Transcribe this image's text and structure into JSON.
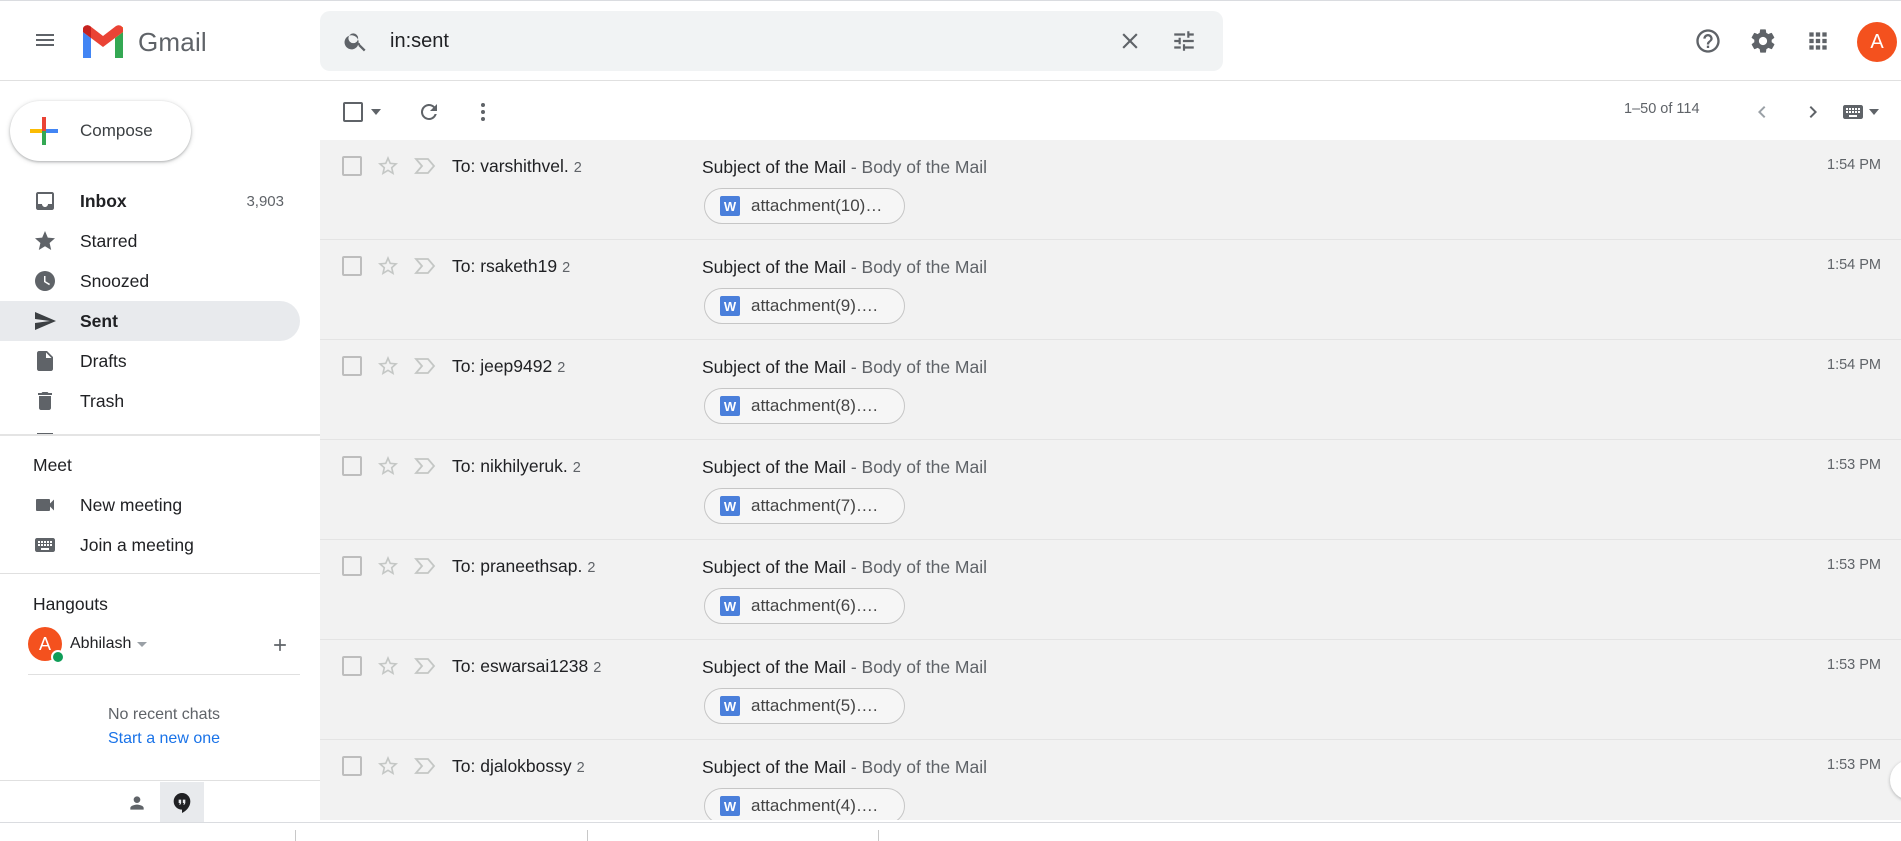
{
  "app": {
    "name": "Gmail",
    "colors": {
      "accent": "#1a73e8",
      "active_nav": "#e8eaed",
      "avatar": "#f4511e",
      "online": "#0f9d58",
      "word_icon": "#4a7fdb"
    }
  },
  "header": {
    "logo_text": "Gmail",
    "search_value": "in:sent",
    "avatar_letter": "A",
    "icons": [
      "menu-icon",
      "search-icon",
      "clear-icon",
      "tune-icon",
      "help-icon",
      "settings-icon",
      "apps-icon"
    ]
  },
  "sidebar": {
    "compose_label": "Compose",
    "items": [
      {
        "label": "Inbox",
        "count": "3,903",
        "icon": "inbox-icon",
        "bold": true,
        "active": false
      },
      {
        "label": "Starred",
        "count": "",
        "icon": "star-icon",
        "bold": false,
        "active": false
      },
      {
        "label": "Snoozed",
        "count": "",
        "icon": "clock-icon",
        "bold": false,
        "active": false
      },
      {
        "label": "Sent",
        "count": "",
        "icon": "send-icon",
        "bold": true,
        "active": true
      },
      {
        "label": "Drafts",
        "count": "",
        "icon": "draft-icon",
        "bold": false,
        "active": false
      },
      {
        "label": "Trash",
        "count": "",
        "icon": "trash-icon",
        "bold": false,
        "active": false
      }
    ],
    "meet": {
      "title": "Meet",
      "new_meeting": "New meeting",
      "join_meeting": "Join a meeting"
    },
    "hangouts": {
      "title": "Hangouts",
      "user_name": "Abhilash",
      "user_initial": "A",
      "no_chats": "No recent chats",
      "start_new": "Start a new one"
    }
  },
  "toolbar": {
    "pager": "1–50 of 114"
  },
  "emails": [
    {
      "to": "To: varshithvel.",
      "count": "2",
      "subject": "Subject of the Mail",
      "snippet": " - Body of the Mail",
      "attachment": "attachment(10)…",
      "time": "1:54 PM"
    },
    {
      "to": "To: rsaketh19",
      "count": "2",
      "subject": "Subject of the Mail",
      "snippet": " - Body of the Mail",
      "attachment": "attachment(9)….",
      "time": "1:54 PM"
    },
    {
      "to": "To: jeep9492",
      "count": "2",
      "subject": "Subject of the Mail",
      "snippet": " - Body of the Mail",
      "attachment": "attachment(8)….",
      "time": "1:54 PM"
    },
    {
      "to": "To: nikhilyeruk.",
      "count": "2",
      "subject": "Subject of the Mail",
      "snippet": " - Body of the Mail",
      "attachment": "attachment(7)….",
      "time": "1:53 PM"
    },
    {
      "to": "To: praneethsap.",
      "count": "2",
      "subject": "Subject of the Mail",
      "snippet": " - Body of the Mail",
      "attachment": "attachment(6)….",
      "time": "1:53 PM"
    },
    {
      "to": "To: eswarsai1238",
      "count": "2",
      "subject": "Subject of the Mail",
      "snippet": " - Body of the Mail",
      "attachment": "attachment(5)….",
      "time": "1:53 PM"
    },
    {
      "to": "To: djalokbossy",
      "count": "2",
      "subject": "Subject of the Mail",
      "snippet": " - Body of the Mail",
      "attachment": "attachment(4)….",
      "time": "1:53 PM"
    }
  ]
}
